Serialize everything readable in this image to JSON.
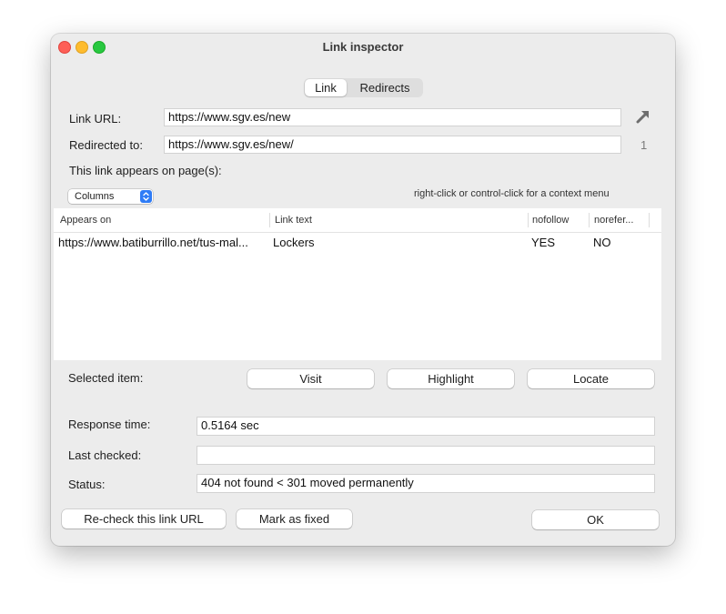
{
  "window": {
    "title": "Link inspector"
  },
  "tabs": [
    {
      "label": "Link"
    },
    {
      "label": "Redirects"
    }
  ],
  "link": {
    "url_label": "Link URL:",
    "url_value": "https://www.sgv.es/new",
    "redirect_label": "Redirected to:",
    "redirect_value": "https://www.sgv.es/new/",
    "redirect_count": "1",
    "appears_label": "This link appears on page(s):"
  },
  "columns_popup": {
    "label": "Columns"
  },
  "context_hint": "right-click or control-click for a context menu",
  "table": {
    "headers": [
      "Appears on",
      "Link text",
      "nofollow",
      "norefer..."
    ],
    "rows": [
      [
        "https://www.batiburrillo.net/tus-mal...",
        "Lockers",
        "YES",
        "NO"
      ]
    ]
  },
  "selected": {
    "label": "Selected item:",
    "visit": "Visit",
    "highlight": "Highlight",
    "locate": "Locate"
  },
  "details": {
    "response_label": "Response time:",
    "response_value": "0.5164 sec",
    "checked_label": "Last checked:",
    "checked_value": "",
    "status_label": "Status:",
    "status_value": "404 not found < 301 moved permanently"
  },
  "footer": {
    "recheck": "Re-check this link URL",
    "mark_fixed": "Mark as fixed",
    "ok": "OK"
  },
  "icons": {
    "redirect": "arrow-up-right-icon",
    "popup": "chevron-updown-icon"
  }
}
